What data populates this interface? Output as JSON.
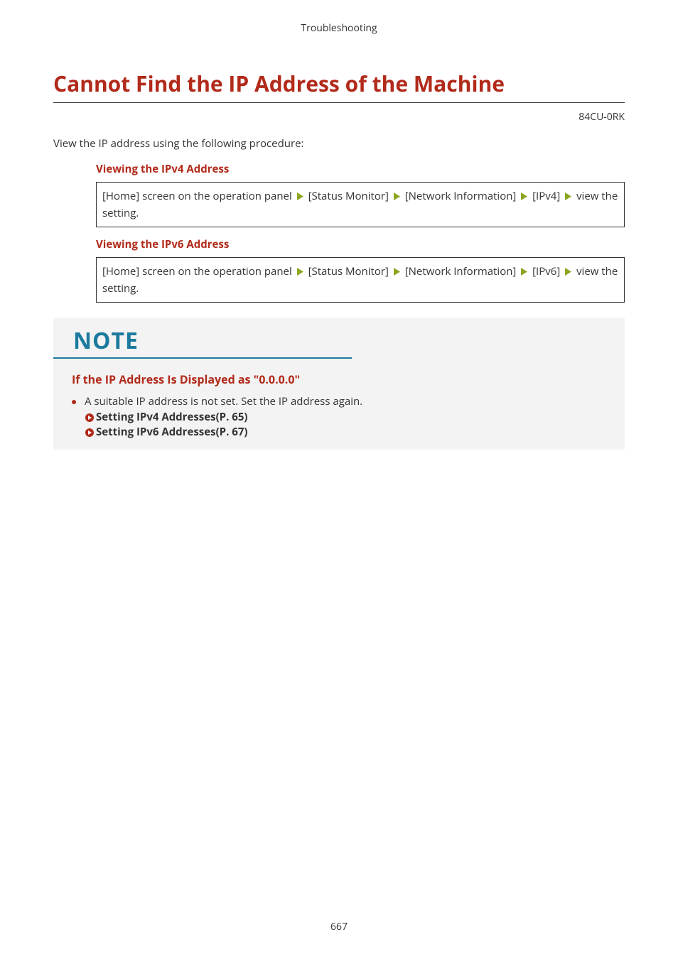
{
  "runningHeader": "Troubleshooting",
  "title": "Cannot Find the IP Address of the Machine",
  "docId": "84CU-0RK",
  "intro": "View the IP address using the following procedure:",
  "sections": [
    {
      "heading": "Viewing the IPv4 Address",
      "steps": {
        "pre": "[Home] screen on the operation panel",
        "s1": "[Status Monitor]",
        "s2": "[Network Information]",
        "s3": "[IPv4]",
        "tail": "view the setting."
      }
    },
    {
      "heading": "Viewing the IPv6 Address",
      "steps": {
        "pre": "[Home] screen on the operation panel",
        "s1": "[Status Monitor]",
        "s2": "[Network Information]",
        "s3": "[IPv6]",
        "tail": "view the setting."
      }
    }
  ],
  "note": {
    "label": "NOTE",
    "subheading": "If the IP Address Is Displayed as \"0.0.0.0\"",
    "bullet": "A suitable IP address is not set. Set the IP address again.",
    "xrefs": [
      "Setting IPv4 Addresses(P. 65)",
      "Setting IPv6 Addresses(P. 67)"
    ]
  },
  "pageNumber": "667"
}
